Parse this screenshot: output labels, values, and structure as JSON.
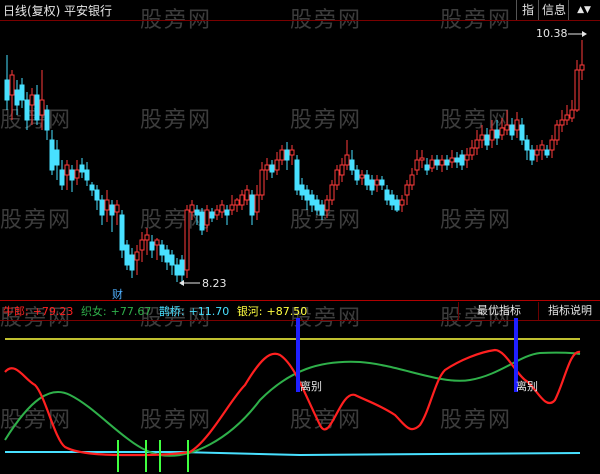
{
  "header": {
    "period_label": "日线(复权)",
    "stock_name": "平安银行",
    "btn_zhi": "指",
    "btn_info": "信息",
    "btn_arrows": "▲▼"
  },
  "price_chart": {
    "high_label": "10.38",
    "low_label": "8.23",
    "cai_label": "财"
  },
  "indicator": {
    "niulang_label": "牛郎:",
    "niulang_value": "+79.23",
    "zhinv_label": "织女:",
    "zhinv_value": "+77.67",
    "queqiao_label": "鹊桥:",
    "queqiao_value": "+11.70",
    "yinhe_label": "银河:",
    "yinhe_value": "+87.50",
    "best_btn": "最优指标",
    "help_btn": "指标说明",
    "libie_1": "离别",
    "libie_2": "离别"
  },
  "watermark": "股旁网",
  "colors": {
    "up": "#ff3b3b",
    "down": "#48e0ff",
    "niulang": "#ff2020",
    "zhinv": "#2fb04a",
    "queqiao": "#48e0ff",
    "yinhe": "#ffff40",
    "marker_green": "#40ff40",
    "marker_blue": "#2020ff",
    "grid_red": "#7a0000"
  }
}
